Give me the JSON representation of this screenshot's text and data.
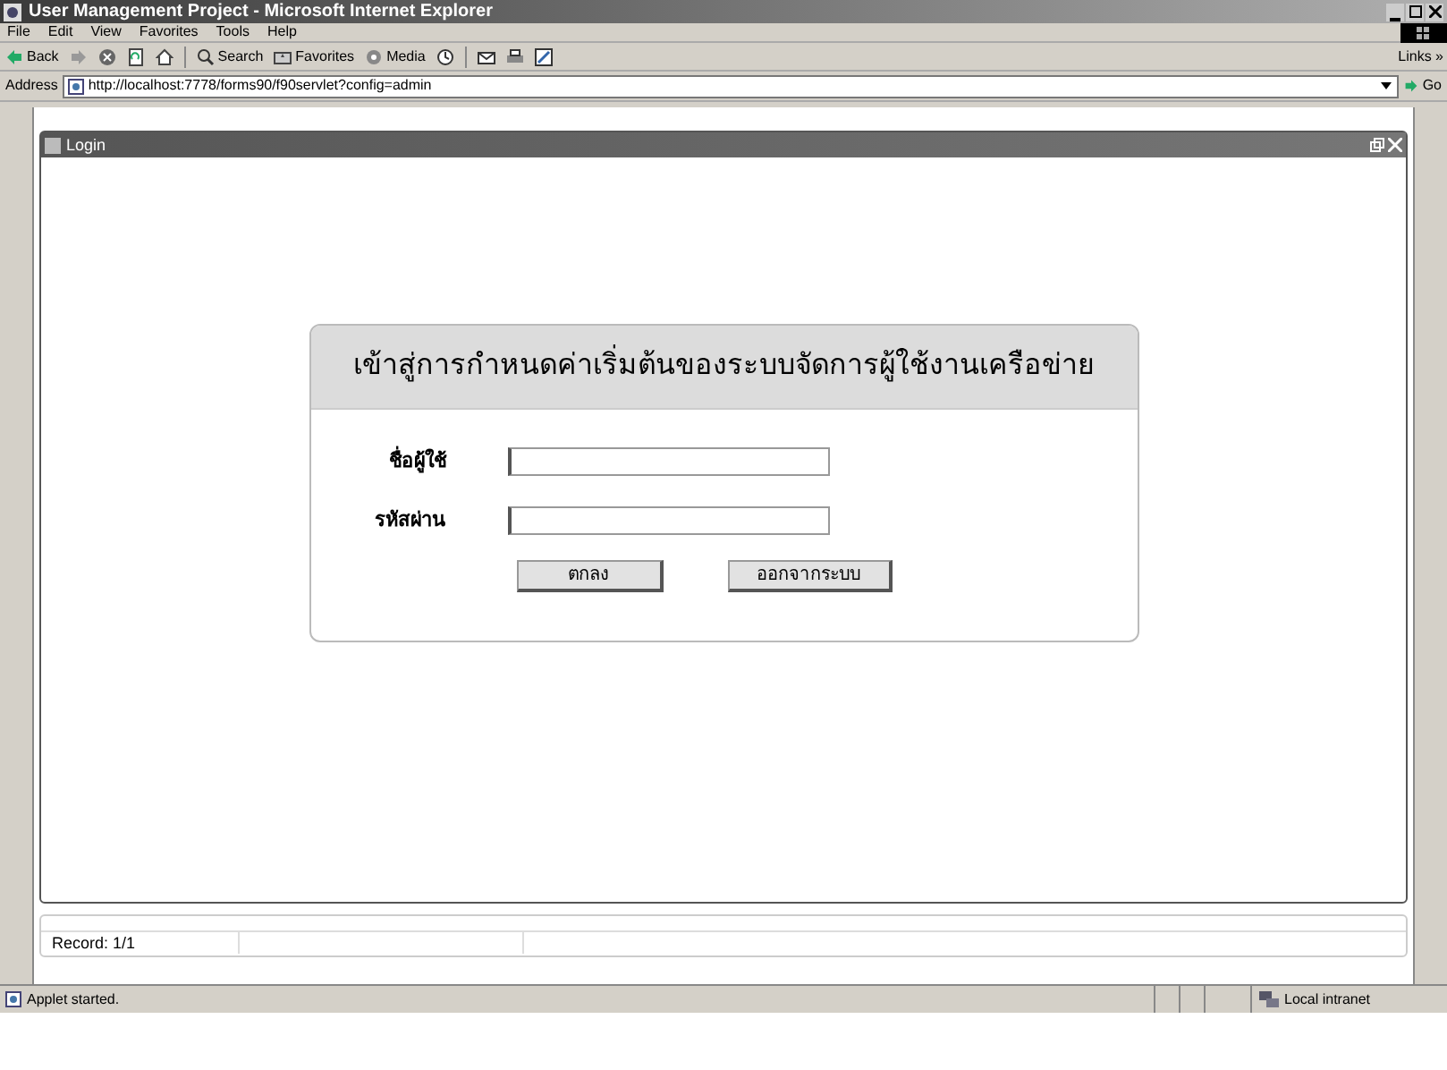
{
  "window": {
    "title": "User Management Project - Microsoft Internet Explorer"
  },
  "menu": [
    "File",
    "Edit",
    "View",
    "Favorites",
    "Tools",
    "Help"
  ],
  "toolbar": [
    {
      "kind": "back",
      "label": "Back"
    },
    {
      "kind": "forward"
    },
    {
      "kind": "stop"
    },
    {
      "kind": "refresh"
    },
    {
      "kind": "home"
    },
    {
      "kind": "search",
      "label": "Search"
    },
    {
      "kind": "favorites",
      "label": "Favorites"
    },
    {
      "kind": "media",
      "label": "Media"
    },
    {
      "kind": "history"
    },
    {
      "kind": "mail"
    },
    {
      "kind": "print"
    },
    {
      "kind": "edit"
    }
  ],
  "links": "Links »",
  "address": {
    "label": "Address",
    "url": "http://localhost:7778/forms90/f90servlet?config=admin",
    "go": "Go"
  },
  "applet": {
    "window_title": "Login",
    "dialog_title": "เข้าสู่การกำหนดค่าเริ่มต้นของระบบจัดการผู้ใช้งานเครือข่าย",
    "fields": [
      {
        "label": "ชื่อผู้ใช้"
      },
      {
        "label": "รหัสผ่าน"
      }
    ],
    "buttons": [
      "ตกลง",
      "ออกจากระบบ"
    ],
    "record": "Record: 1/1"
  },
  "status_bar": {
    "text": "Applet started.",
    "zone": "Local intranet"
  }
}
